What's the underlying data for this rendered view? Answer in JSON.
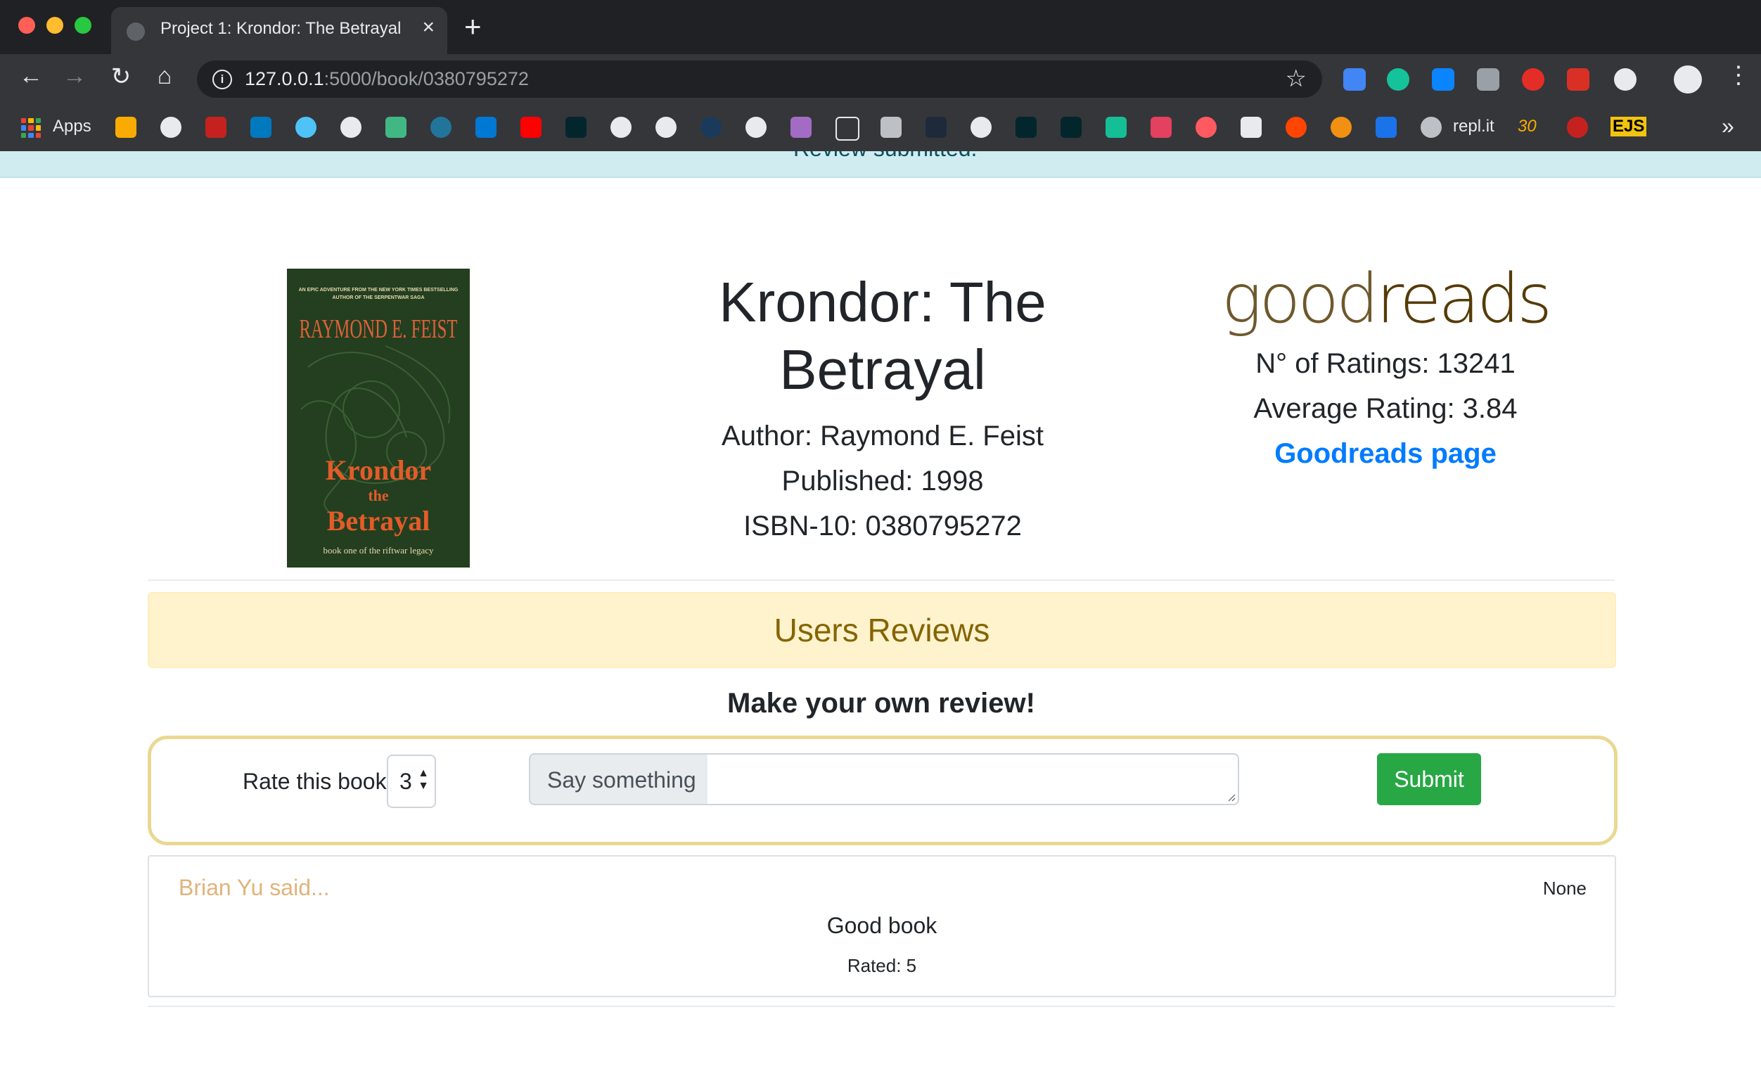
{
  "browser": {
    "tab_title": "Project 1: Krondor: The Betrayal",
    "url_host": "127.0.0.1",
    "url_rest": ":5000/book/0380795272",
    "bookmarks_apps_label": "Apps",
    "bookmark_replit_label": "repl.it",
    "bookmark_30_label": "30",
    "bookmark_ejs_label": "EJS"
  },
  "alert": {
    "text": "Review submitted."
  },
  "cover": {
    "tagline1": "AN EPIC ADVENTURE FROM THE NEW YORK TIMES BESTSELLING",
    "tagline2": "AUTHOR OF THE SERPENTWAR SAGA",
    "author": "RAYMOND E. FEIST",
    "title1": "Krondor",
    "title2": "the",
    "title3": "Betrayal",
    "subtitle": "book one of the riftwar legacy"
  },
  "book": {
    "title": "Krondor: The Betrayal",
    "author": "Author: Raymond E. Feist",
    "published": "Published: 1998",
    "isbn": "ISBN-10: 0380795272"
  },
  "goodreads": {
    "logo_good": "good",
    "logo_reads": "reads",
    "ratings_count": "N° of Ratings: 13241",
    "average_rating": "Average Rating: 3.84",
    "link_label": "Goodreads page"
  },
  "reviews": {
    "heading": "Users Reviews",
    "make_review": "Make your own review!",
    "form": {
      "rate_label": "Rate this book",
      "rate_value": "3",
      "say_label": "Say something",
      "textarea_value": "",
      "submit_label": "Submit"
    },
    "items": [
      {
        "author": "Brian Yu said...",
        "date": "None",
        "text": "Good book",
        "rated": "Rated: 5"
      }
    ]
  }
}
